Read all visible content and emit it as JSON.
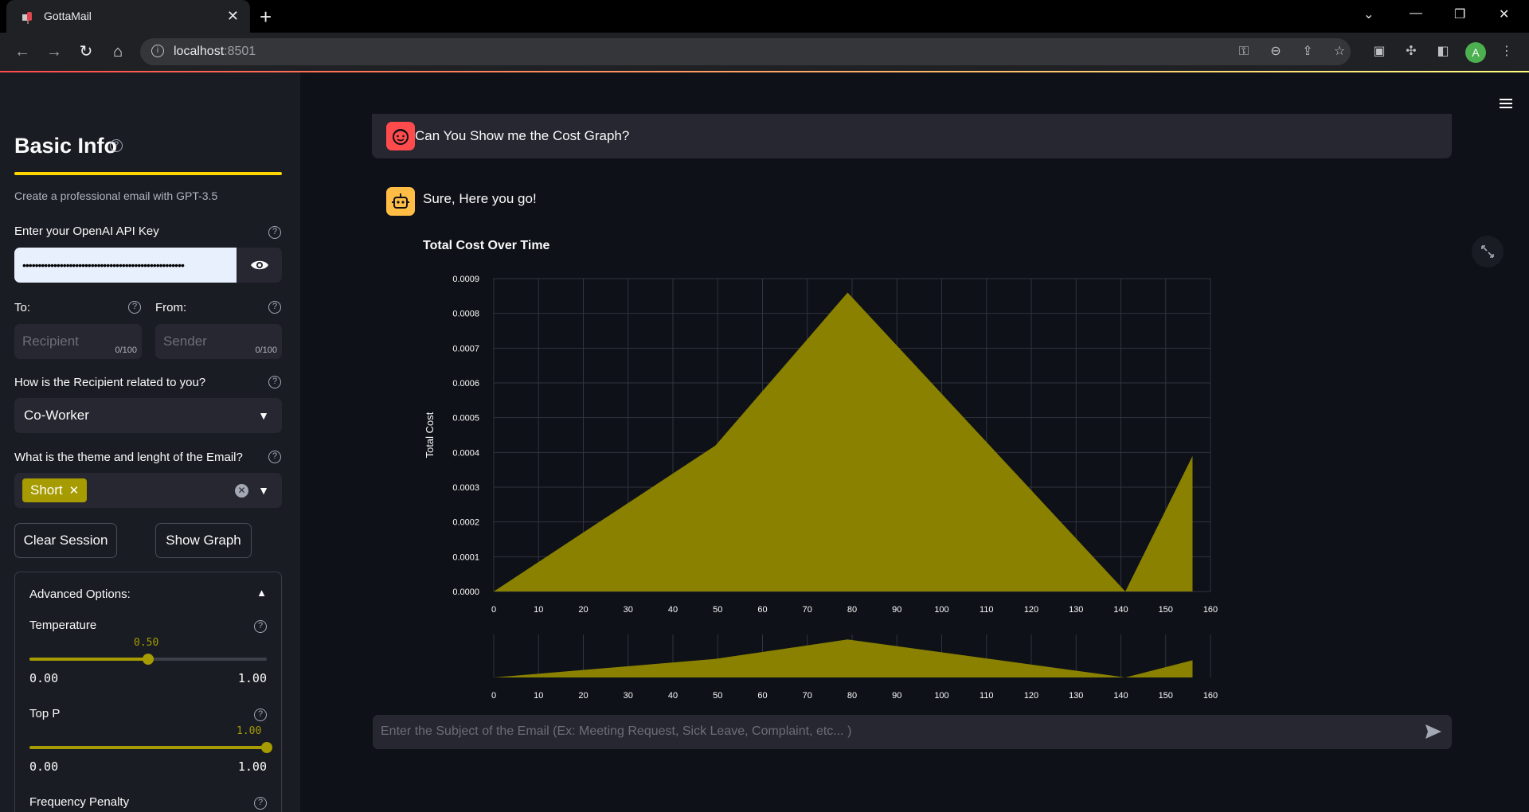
{
  "browser": {
    "tab_title": "GottaMail",
    "url_host": "localhost",
    "url_port": ":8501",
    "profile_initial": "A"
  },
  "sidebar": {
    "title": "Basic Info",
    "caption": "Create a professional email with GPT-3.5",
    "api_key_label": "Enter your OpenAI API Key",
    "api_key_value": "••••••••••••••••••••••••••••••••••••••••••••••••••••",
    "to_label": "To:",
    "from_label": "From:",
    "to_placeholder": "Recipient",
    "from_placeholder": "Sender",
    "to_count": "0/100",
    "from_count": "0/100",
    "relation_label": "How is the Recipient related to you?",
    "relation_value": "Co-Worker",
    "theme_label": "What is the theme and lenght of the Email?",
    "theme_tag": "Short",
    "clear_button": "Clear Session",
    "graph_button": "Show Graph",
    "advanced_title": "Advanced Options:",
    "temperature_label": "Temperature",
    "temperature_value": "0.50",
    "temperature_fraction": 0.5,
    "temperature_min": "0.00",
    "temperature_max": "1.00",
    "top_p_label": "Top P",
    "top_p_value": "1.00",
    "top_p_fraction": 1.0,
    "top_p_min": "0.00",
    "top_p_max": "1.00",
    "freq_label": "Frequency Penalty"
  },
  "chat": {
    "user_message": "Can You Show me the Cost Graph?",
    "bot_message": "Sure, Here you go!",
    "input_placeholder": "Enter the Subject of the Email (Ex: Meeting Request, Sick Leave, Complaint, etc... )"
  },
  "colors": {
    "accent": "#a69b00",
    "area": "#8a8100",
    "divider": "#ffd600",
    "user_avatar": "#ff4b4b",
    "bot_avatar": "#ffbd45"
  },
  "chart_data": {
    "type": "area",
    "title": "Total Cost Over Time",
    "xlabel": "",
    "ylabel": "Total Cost",
    "xlim": [
      0,
      160
    ],
    "ylim": [
      0,
      0.0009
    ],
    "x_ticks": [
      "0",
      "10",
      "20",
      "30",
      "40",
      "50",
      "60",
      "70",
      "80",
      "90",
      "100",
      "110",
      "120",
      "130",
      "140",
      "150",
      "160"
    ],
    "y_ticks": [
      "0.0000",
      "0.0001",
      "0.0002",
      "0.0003",
      "0.0004",
      "0.0005",
      "0.0006",
      "0.0007",
      "0.0008",
      "0.0009"
    ],
    "x": [
      0,
      49.5,
      79,
      141,
      156,
      156
    ],
    "y": [
      0,
      0.00042,
      0.00086,
      0,
      0.00039,
      0
    ],
    "grid": true
  }
}
